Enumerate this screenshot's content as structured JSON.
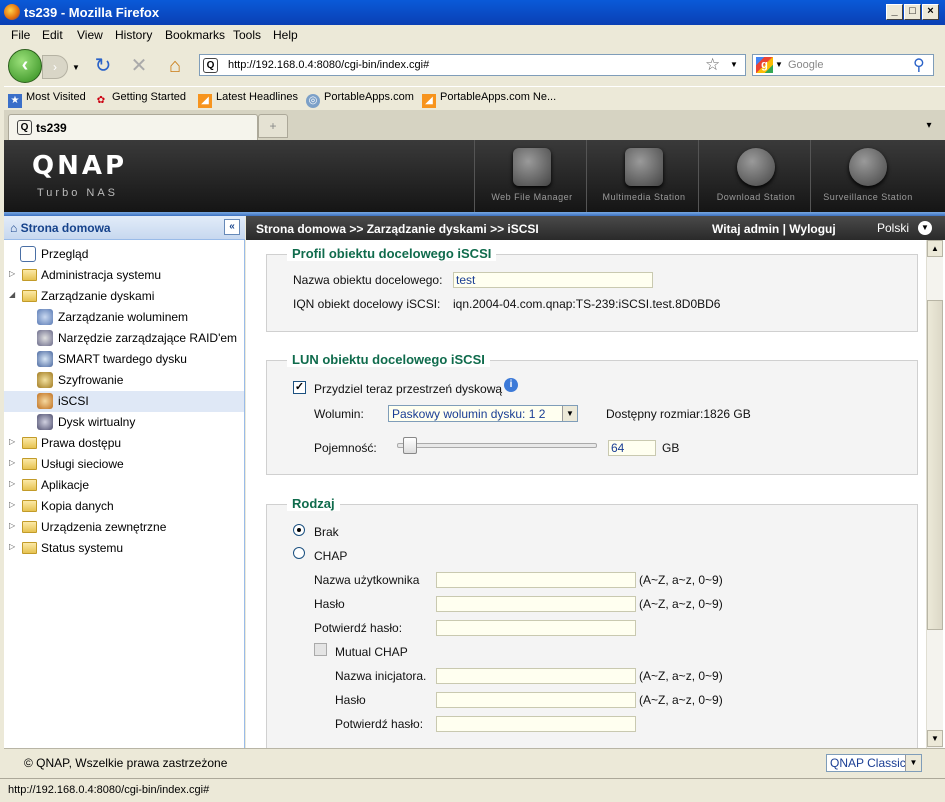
{
  "window": {
    "title": "ts239 - Mozilla Firefox"
  },
  "menu": {
    "file": "File",
    "edit": "Edit",
    "view": "View",
    "history": "History",
    "bookmarks": "Bookmarks",
    "tools": "Tools",
    "help": "Help"
  },
  "nav": {
    "url": "http://192.168.0.4:8080/cgi-bin/index.cgi#",
    "search_placeholder": "Google"
  },
  "bookmarks": [
    "Most Visited",
    "Getting Started",
    "Latest Headlines",
    "PortableApps.com",
    "PortableApps.com Ne..."
  ],
  "tab": {
    "label": "ts239"
  },
  "qnap": {
    "logo": "QNAP",
    "subtitle": "Turbo NAS",
    "apps": [
      "Web File Manager",
      "Multimedia Station",
      "Download Station",
      "Surveillance Station"
    ]
  },
  "sidebar": {
    "title": "Strona domowa",
    "items": [
      {
        "label": "Przegląd"
      },
      {
        "label": "Administracja systemu"
      },
      {
        "label": "Zarządzanie dyskami"
      },
      {
        "label": "Zarządzanie woluminem"
      },
      {
        "label": "Narzędzie zarządzające RAID'em"
      },
      {
        "label": "SMART twardego dysku"
      },
      {
        "label": "Szyfrowanie"
      },
      {
        "label": "iSCSI"
      },
      {
        "label": "Dysk wirtualny"
      },
      {
        "label": "Prawa dostępu"
      },
      {
        "label": "Usługi sieciowe"
      },
      {
        "label": "Aplikacje"
      },
      {
        "label": "Kopia danych"
      },
      {
        "label": "Urządzenia zewnętrzne"
      },
      {
        "label": "Status systemu"
      }
    ]
  },
  "header": {
    "breadcrumb": "Strona domowa >> Zarządzanie dyskami >> iSCSI",
    "welcome": "Witaj admin",
    "sep": "|",
    "logout": "Wyloguj",
    "language": "Polski"
  },
  "profile": {
    "legend": "Profil obiektu docelowego iSCSI",
    "name_label": "Nazwa obiektu docelowego:",
    "name_value": "test",
    "iqn_label": "IQN obiekt docelowy iSCSI:",
    "iqn_value": "iqn.2004-04.com.qnap:TS-239:iSCSI.test.8D0BD6"
  },
  "lun": {
    "legend": "LUN obiektu docelowego iSCSI",
    "allocate_label": "Przydziel teraz przestrzeń dyskową",
    "allocate_checked": true,
    "volume_label": "Wolumin:",
    "volume_value": "Paskowy wolumin dysku: 1 2",
    "available": "Dostępny rozmiar:1826 GB",
    "capacity_label": "Pojemność:",
    "capacity_value": "64",
    "capacity_unit": "GB",
    "capacity_fraction": 0.035
  },
  "auth": {
    "legend": "Rodzaj",
    "none_label": "Brak",
    "chap_label": "CHAP",
    "selected": "Brak",
    "username_label": "Nazwa użytkownika",
    "password_label": "Hasło",
    "confirm_label": "Potwierdź hasło:",
    "hint": "(A~Z, a~z, 0~9)",
    "mutual_label": "Mutual CHAP",
    "initiator_label": "Nazwa inicjatora.",
    "mutual_password_label": "Hasło",
    "mutual_confirm_label": "Potwierdź hasło:"
  },
  "footer": {
    "copyright": "© QNAP, Wszelkie prawa zastrzeżone",
    "theme": "QNAP Classic"
  },
  "status": {
    "text": "http://192.168.0.4:8080/cgi-bin/index.cgi#"
  }
}
